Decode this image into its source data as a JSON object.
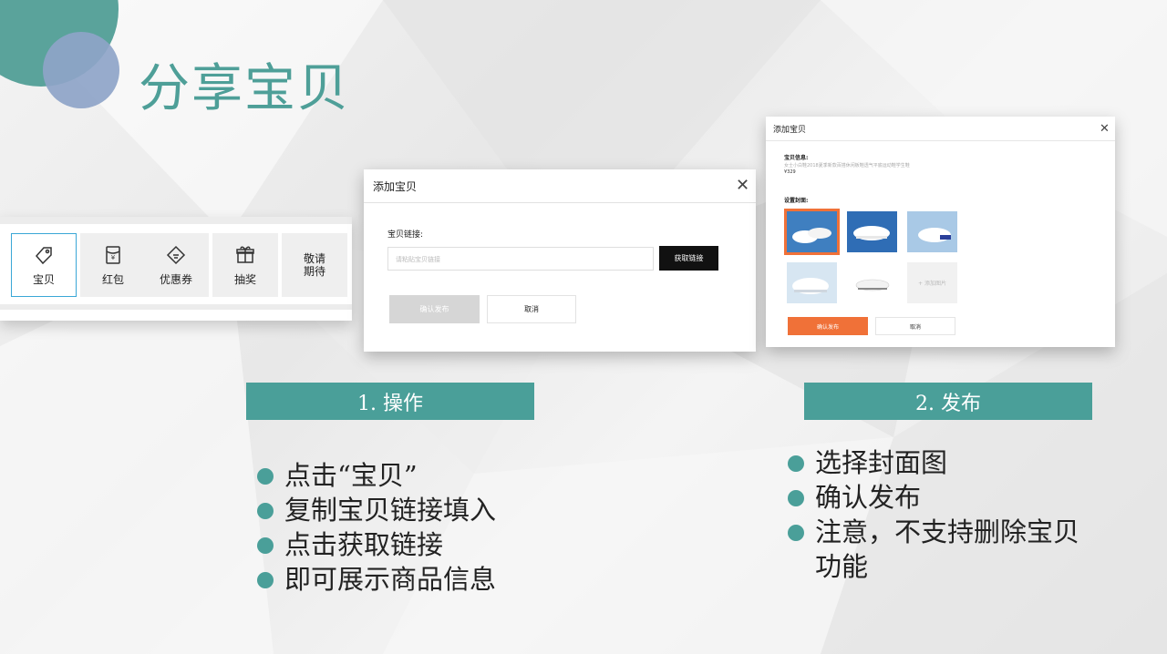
{
  "page_title": "分享宝贝",
  "colors": {
    "accent": "#4a9f99",
    "orange": "#f07138",
    "highlight": "#3aa7d6"
  },
  "toolbar": {
    "items": [
      {
        "label": "宝贝",
        "icon": "tag-icon",
        "active": true
      },
      {
        "label": "红包",
        "icon": "red-envelope-icon",
        "active": false
      },
      {
        "label": "优惠券",
        "icon": "coupon-icon",
        "active": false
      },
      {
        "label": "抽奖",
        "icon": "gift-icon",
        "active": false
      },
      {
        "label": "敬请期待",
        "icon": "",
        "active": false
      }
    ]
  },
  "dialog_link": {
    "title": "添加宝贝",
    "field_label": "宝贝链接:",
    "placeholder": "请粘贴宝贝链接",
    "fetch_button": "获取链接",
    "confirm_button": "确认发布",
    "cancel_button": "取消"
  },
  "dialog_publish": {
    "title": "添加宝贝",
    "info_label": "宝贝信息:",
    "info_text": "女士小白鞋2018夏季新款百搭休闲板鞋透气平底运动鞋学生鞋",
    "price": "¥329",
    "cover_label": "设置封面:",
    "add_image": "+ 添加图片",
    "confirm_button": "确认发布",
    "cancel_button": "取消"
  },
  "steps": [
    {
      "banner": "1. 操作",
      "bullets": [
        "点击“宝贝”",
        "复制宝贝链接填入",
        "点击获取链接",
        "即可展示商品信息"
      ]
    },
    {
      "banner": "2. 发布",
      "bullets": [
        "选择封面图",
        "确认发布",
        "注意，不支持删除宝贝"
      ],
      "continuation": "功能"
    }
  ]
}
